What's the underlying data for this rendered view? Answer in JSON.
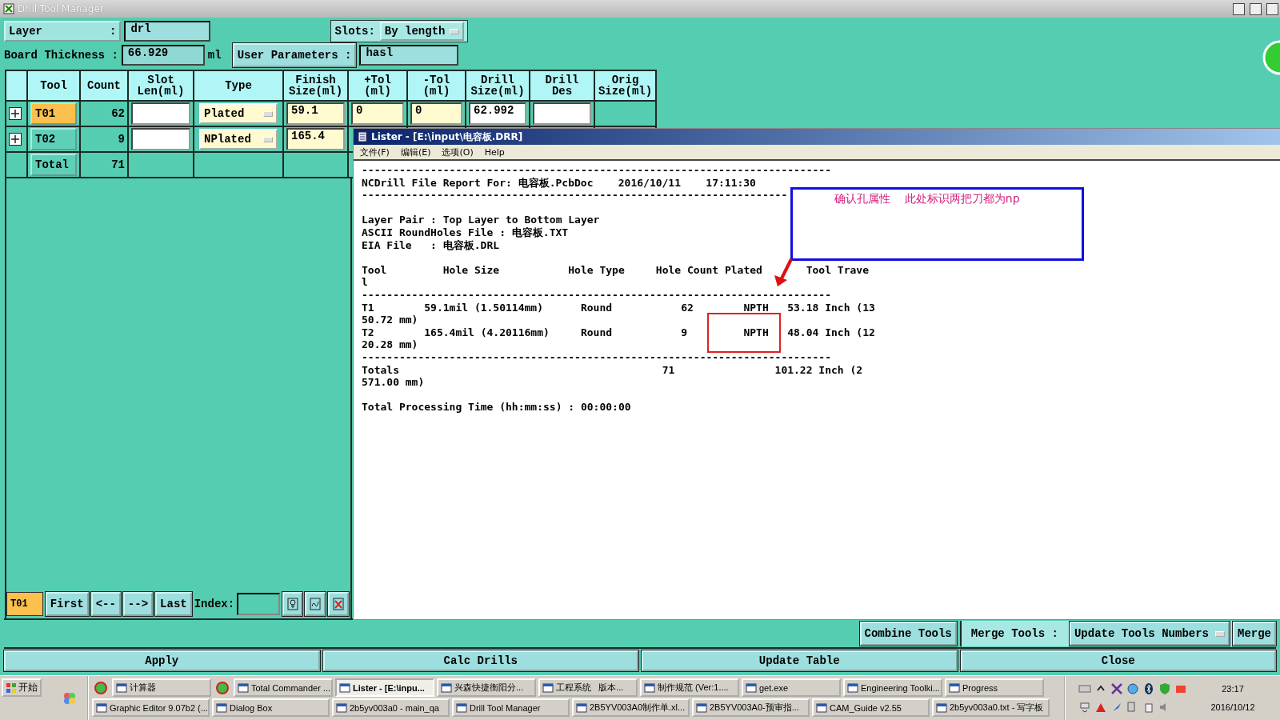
{
  "window": {
    "title": "Drill Tool Manager"
  },
  "layer": {
    "label": "Layer          :",
    "value": "drl"
  },
  "slots": {
    "label": "Slots:",
    "value": "By length"
  },
  "board_thickness": {
    "label": "Board Thickness :",
    "value": "66.929",
    "unit": "ml"
  },
  "user_parameters": {
    "label": "User Parameters :",
    "value": "hasl"
  },
  "table": {
    "columns": [
      "Tool",
      "Count",
      "Slot\nLen(ml)",
      "Type",
      "Finish\nSize(ml)",
      "+Tol\n(ml)",
      "-Tol\n(ml)",
      "Drill\nSize(ml)",
      "Drill\nDes",
      "Orig\nSize(ml)"
    ],
    "rows": [
      {
        "kind": "tool",
        "tool": "T01",
        "selected": true,
        "count": "62",
        "type": "Plated",
        "finish": "59.1",
        "plus_tol": "0",
        "minus_tol": "0",
        "drill_size": "62.992"
      },
      {
        "kind": "tool",
        "tool": "T02",
        "selected": false,
        "count": "9",
        "type": "NPlated",
        "finish": "165.4"
      },
      {
        "kind": "total",
        "tool": "Total",
        "count": "71"
      }
    ]
  },
  "navigation": {
    "current": "T01",
    "buttons": [
      "First",
      "<--",
      "-->",
      "Last"
    ],
    "index_label": "Index:"
  },
  "merge": {
    "combine": "Combine Tools",
    "label": "Merge Tools :",
    "mode": "Update Tools Numbers",
    "button": "Merge"
  },
  "actions": [
    "Apply",
    "Calc Drills",
    "Update Table",
    "Close"
  ],
  "lister": {
    "title": "Lister - [E:\\input\\电容板.DRR]",
    "menu": [
      "文件(F)",
      "编辑(E)",
      "选项(O)",
      "Help"
    ],
    "blocks": [
      [
        "---------------------------------------------------------------------------",
        "NCDrill File Report For: 电容板.PcbDoc    2016/10/11    17:11:30",
        "--------------------------------------------------------------------"
      ],
      [
        "Layer Pair : Top Layer to Bottom Layer",
        "ASCII RoundHoles File : 电容板.TXT",
        "EIA File   : 电容板.DRL"
      ],
      [
        "Tool         Hole Size           Hole Type     Hole Count Plated       Tool Trave",
        "l",
        "---------------------------------------------------------------------------",
        "T1        59.1mil (1.50114mm)      Round           62        NPTH   53.18 Inch (13",
        "50.72 mm)",
        "T2        165.4mil (4.20116mm)     Round           9         NPTH   48.04 Inch (12",
        "20.28 mm)",
        "---------------------------------------------------------------------------",
        "Totals                                          71                101.22 Inch (2",
        "571.00 mm)"
      ],
      [
        "Total Processing Time (hh:mm:ss) : 00:00:00"
      ]
    ],
    "annotation": "确认孔属性    此处标识两把刀都为np"
  },
  "taskbar": {
    "start": "开始",
    "row1": [
      {
        "kind": "launcher"
      },
      {
        "kind": "task",
        "label": "计算器",
        "selected": false
      },
      {
        "kind": "launcher"
      },
      {
        "kind": "task",
        "label": "Total Commander ...",
        "selected": false
      },
      {
        "kind": "task",
        "label": "Lister - [E:\\inpu...",
        "selected": true
      },
      {
        "kind": "task",
        "label": "兴森快捷衡阳分...",
        "selected": false
      },
      {
        "kind": "task",
        "label": "工程系统   版本...",
        "selected": false
      },
      {
        "kind": "task",
        "label": "制作规范 (Ver:1....",
        "selected": false
      },
      {
        "kind": "task",
        "label": "get.exe",
        "selected": false
      },
      {
        "kind": "task",
        "label": "Engineering Toolki...",
        "selected": false
      },
      {
        "kind": "task",
        "label": "Progress",
        "selected": false
      }
    ],
    "row2": [
      {
        "kind": "task",
        "label": "Graphic Editor 9.07b2 (...",
        "selected": false
      },
      {
        "kind": "task",
        "label": "Dialog Box",
        "selected": false
      },
      {
        "kind": "task",
        "label": "2b5yv003a0 - main_qa",
        "selected": false
      },
      {
        "kind": "task",
        "label": "Drill Tool Manager",
        "selected": false
      },
      {
        "kind": "task",
        "label": "2B5YV003A0制作单.xl...",
        "selected": false
      },
      {
        "kind": "task",
        "label": "2B5YV003A0-预审指...",
        "selected": false
      },
      {
        "kind": "task",
        "label": "CAM_Guide v2.55",
        "selected": false
      },
      {
        "kind": "task",
        "label": "2b5yv003a0.txt - 写字板",
        "selected": false
      }
    ],
    "time": "23:17",
    "date": "2016/10/12"
  }
}
